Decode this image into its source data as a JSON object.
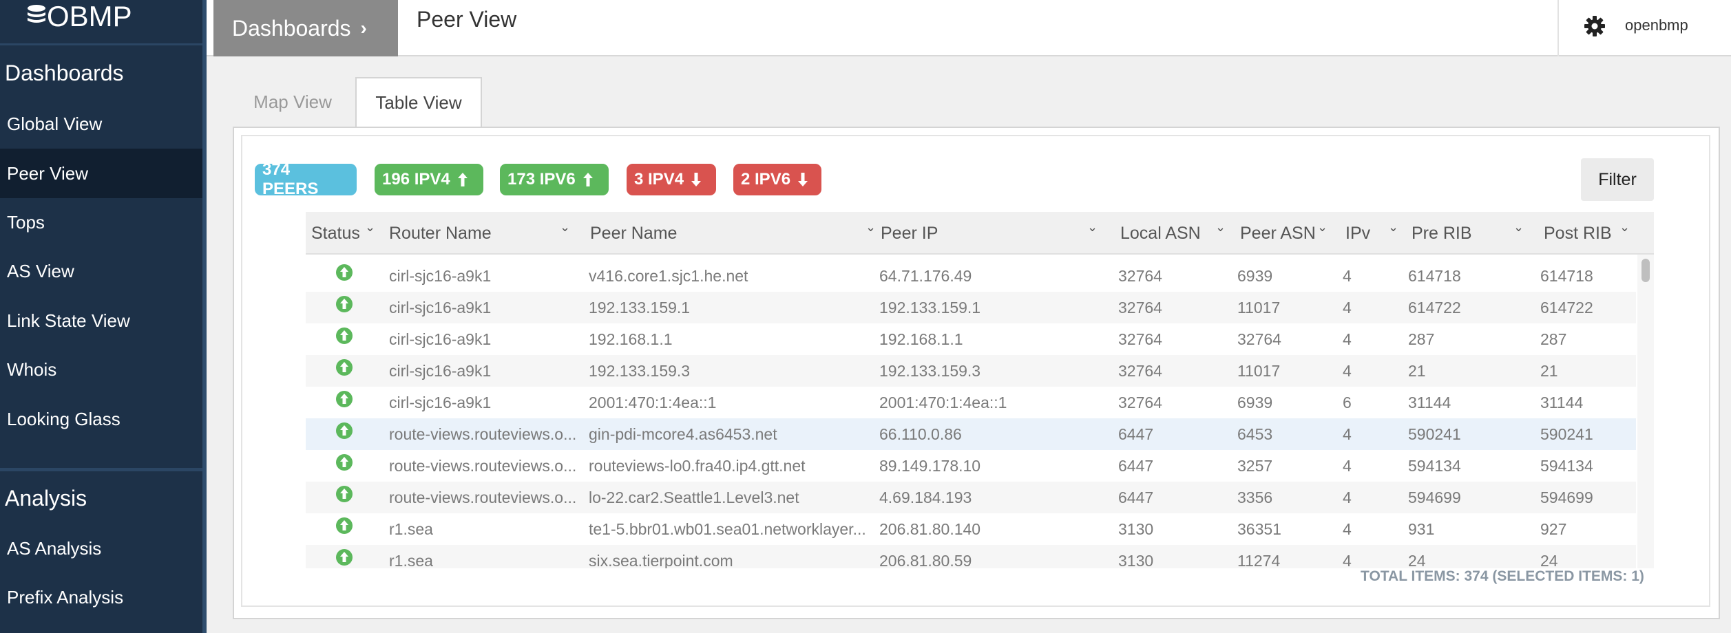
{
  "app": {
    "logo_text": "OBMP"
  },
  "sidebar": {
    "sections": [
      {
        "title": "Dashboards",
        "items": [
          "Global View",
          "Peer View",
          "Tops",
          "AS View",
          "Link State View",
          "Whois",
          "Looking Glass"
        ]
      },
      {
        "title": "Analysis",
        "items": [
          "AS Analysis",
          "Prefix Analysis"
        ]
      }
    ],
    "active_item": "Peer View"
  },
  "header": {
    "breadcrumb": "Dashboards",
    "title": "Peer View",
    "username": "openbmp"
  },
  "tabs": [
    {
      "label": "Map View",
      "active": false
    },
    {
      "label": "Table View",
      "active": true
    }
  ],
  "badges": [
    {
      "text": "374 PEERS",
      "color": "#5bc0de",
      "arrow": ""
    },
    {
      "text": "196 IPV4",
      "color": "#5cb85c",
      "arrow": "up"
    },
    {
      "text": "173 IPV6",
      "color": "#5cb85c",
      "arrow": "up"
    },
    {
      "text": "3 IPV4",
      "color": "#d9534f",
      "arrow": "down"
    },
    {
      "text": "2 IPV6",
      "color": "#d9534f",
      "arrow": "down"
    }
  ],
  "filter_label": "Filter",
  "table": {
    "columns": [
      "Status",
      "Router Name",
      "Peer Name",
      "Peer IP",
      "Local ASN",
      "Peer ASN",
      "IPv",
      "Pre RIB",
      "Post RIB"
    ],
    "rows": [
      {
        "status": "up",
        "router": "cirl-sjc16-a9k1",
        "peer_name": "v416.core1.sjc1.he.net",
        "peer_ip": "64.71.176.49",
        "local_asn": "32764",
        "peer_asn": "6939",
        "ipv": "4",
        "pre_rib": "614718",
        "post_rib": "614718"
      },
      {
        "status": "up",
        "router": "cirl-sjc16-a9k1",
        "peer_name": "192.133.159.1",
        "peer_ip": "192.133.159.1",
        "local_asn": "32764",
        "peer_asn": "11017",
        "ipv": "4",
        "pre_rib": "614722",
        "post_rib": "614722"
      },
      {
        "status": "up",
        "router": "cirl-sjc16-a9k1",
        "peer_name": "192.168.1.1",
        "peer_ip": "192.168.1.1",
        "local_asn": "32764",
        "peer_asn": "32764",
        "ipv": "4",
        "pre_rib": "287",
        "post_rib": "287"
      },
      {
        "status": "up",
        "router": "cirl-sjc16-a9k1",
        "peer_name": "192.133.159.3",
        "peer_ip": "192.133.159.3",
        "local_asn": "32764",
        "peer_asn": "11017",
        "ipv": "4",
        "pre_rib": "21",
        "post_rib": "21"
      },
      {
        "status": "up",
        "router": "cirl-sjc16-a9k1",
        "peer_name": "2001:470:1:4ea::1",
        "peer_ip": "2001:470:1:4ea::1",
        "local_asn": "32764",
        "peer_asn": "6939",
        "ipv": "6",
        "pre_rib": "31144",
        "post_rib": "31144"
      },
      {
        "status": "up",
        "router": "route-views.routeviews.o...",
        "peer_name": "gin-pdi-mcore4.as6453.net",
        "peer_ip": "66.110.0.86",
        "local_asn": "6447",
        "peer_asn": "6453",
        "ipv": "4",
        "pre_rib": "590241",
        "post_rib": "590241"
      },
      {
        "status": "up",
        "router": "route-views.routeviews.o...",
        "peer_name": "routeviews-lo0.fra40.ip4.gtt.net",
        "peer_ip": "89.149.178.10",
        "local_asn": "6447",
        "peer_asn": "3257",
        "ipv": "4",
        "pre_rib": "594134",
        "post_rib": "594134"
      },
      {
        "status": "up",
        "router": "route-views.routeviews.o...",
        "peer_name": "lo-22.car2.Seattle1.Level3.net",
        "peer_ip": "4.69.184.193",
        "local_asn": "6447",
        "peer_asn": "3356",
        "ipv": "4",
        "pre_rib": "594699",
        "post_rib": "594699"
      },
      {
        "status": "up",
        "router": "r1.sea",
        "peer_name": "te1-5.bbr01.wb01.sea01.networklayer...",
        "peer_ip": "206.81.80.140",
        "local_asn": "3130",
        "peer_asn": "36351",
        "ipv": "4",
        "pre_rib": "931",
        "post_rib": "927"
      },
      {
        "status": "up",
        "router": "r1.sea",
        "peer_name": "six.sea.tierpoint.com",
        "peer_ip": "206.81.80.59",
        "local_asn": "3130",
        "peer_asn": "11274",
        "ipv": "4",
        "pre_rib": "24",
        "post_rib": "24"
      }
    ],
    "selected_row": 5,
    "footer": "TOTAL ITEMS: 374 (SELECTED ITEMS: 1)"
  },
  "colors": {
    "sidebar_bg": "#1d3148",
    "status_up": "#5cb85c",
    "badge_info": "#5bc0de",
    "badge_success": "#5cb85c",
    "badge_danger": "#d9534f"
  }
}
